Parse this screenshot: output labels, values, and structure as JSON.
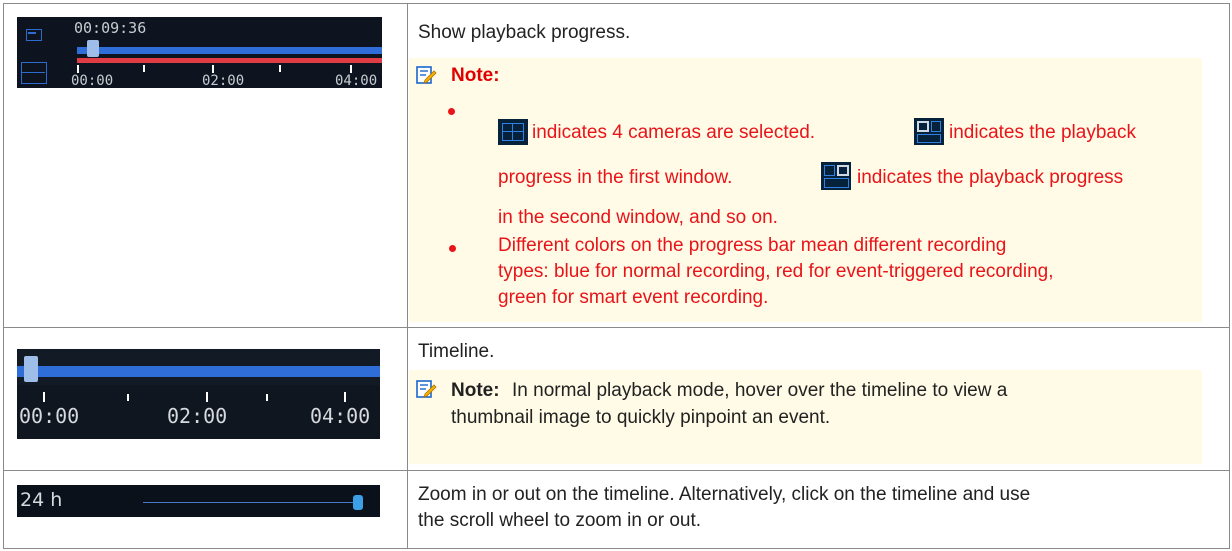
{
  "rows": [
    {
      "description": "Show playback progress.",
      "timeline": {
        "current_time": "00:09:36",
        "ticks": [
          "00:00",
          "02:00",
          "04:00"
        ],
        "progress": 0.02
      },
      "note": {
        "label": "Note:",
        "line1_a": "indicates 4 cameras are selected.",
        "line1_b": "indicates the playback",
        "line2_a": "progress in the first window.",
        "line2_b": "indicates the playback progress",
        "line3": "in the second window, and so on.",
        "bullet2": [
          "Different colors on the progress bar mean different recording",
          "types: blue for normal recording, red for event-triggered recording,",
          "green for smart event recording."
        ]
      }
    },
    {
      "description": "Timeline.",
      "timeline": {
        "ticks": [
          "00:00",
          "02:00",
          "04:00"
        ]
      },
      "note": {
        "label": "Note:",
        "lines": [
          "In normal playback mode, hover over the timeline to view a",
          "thumbnail image to quickly pinpoint an event."
        ]
      }
    },
    {
      "description_lines": [
        "Zoom in or out on the timeline. Alternatively, click on the timeline and use",
        "the scroll wheel to zoom in or out."
      ],
      "zoom": {
        "label": "24 h",
        "level": 1.0
      }
    }
  ],
  "colors": {
    "note_red": "#e8141a",
    "timeline_blue": "#2f6ed8",
    "event_red": "#e03c46",
    "note_bg": "#fffbe6"
  }
}
